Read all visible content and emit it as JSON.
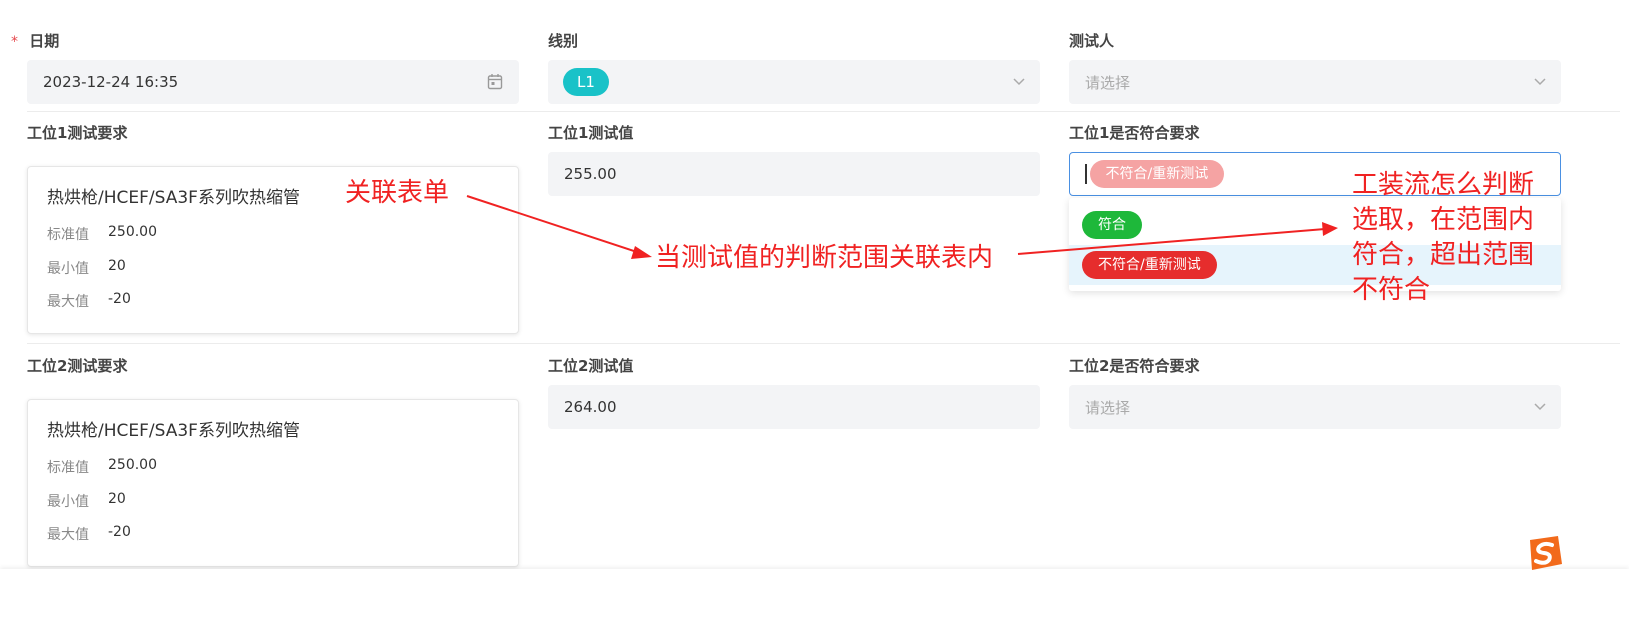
{
  "form": {
    "date": {
      "required_mark": "*",
      "label": "日期",
      "value": "2023-12-24 16:35"
    },
    "line": {
      "label": "线别",
      "value_tag": "L1"
    },
    "tester": {
      "label": "测试人",
      "placeholder": "请选择"
    },
    "station1": {
      "requirement_label": "工位1测试要求",
      "card": {
        "title": "热烘枪/HCEF/SA3F系列吹热缩管",
        "rows": [
          {
            "key": "标准值",
            "value": "250.00"
          },
          {
            "key": "最小值",
            "value": "20"
          },
          {
            "key": "最大值",
            "value": "-20"
          }
        ]
      },
      "value_label": "工位1测试值",
      "value": "255.00",
      "conform_label": "工位1是否符合要求",
      "conform_selected": "不符合/重新测试",
      "dropdown_options": [
        {
          "label": "符合",
          "color": "#1eb83a"
        },
        {
          "label": "不符合/重新测试",
          "color": "#e62d2d"
        }
      ]
    },
    "station2": {
      "requirement_label": "工位2测试要求",
      "card": {
        "title": "热烘枪/HCEF/SA3F系列吹热缩管",
        "rows": [
          {
            "key": "标准值",
            "value": "250.00"
          },
          {
            "key": "最小值",
            "value": "20"
          },
          {
            "key": "最大值",
            "value": "-20"
          }
        ]
      },
      "value_label": "工位2测试值",
      "value": "264.00",
      "conform_label": "工位2是否符合要求",
      "conform_placeholder": "请选择"
    }
  },
  "annotations": {
    "related_form": "关联表单",
    "range_note": "当测试值的判断范围关联表内",
    "flow_note": [
      "工装流怎么判断",
      "选取，在范围内",
      "符合，超出范围",
      "不符合"
    ]
  },
  "colors": {
    "line_tag": "#19c2c8",
    "selected_tag": "#f5a3a3",
    "annotation": "#f02222",
    "focus_border": "#4a90e2",
    "dropdown_highlight": "#e6f4fc"
  },
  "icons": {
    "calendar": "calendar-icon",
    "chevron": "chevron-down-icon",
    "ime_logo": "sogou-ime-icon"
  }
}
